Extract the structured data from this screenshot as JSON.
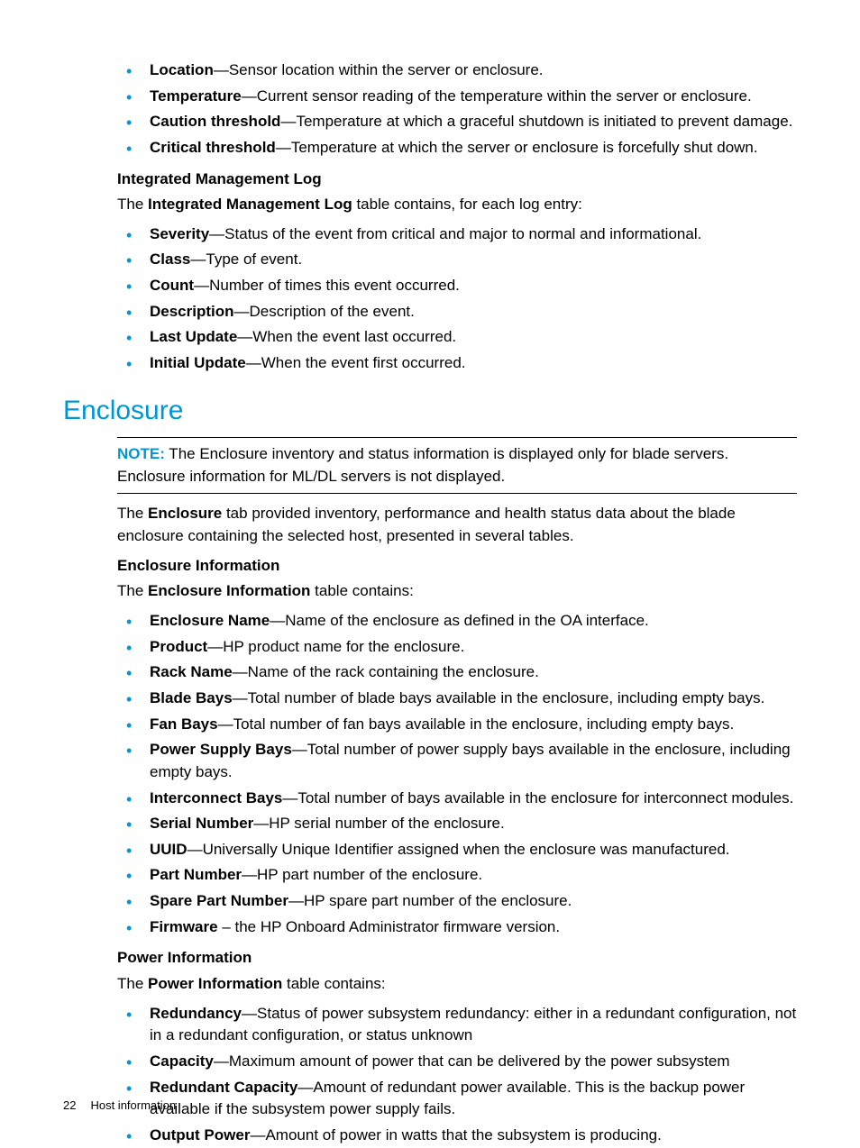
{
  "sensors": {
    "items": [
      {
        "term": "Location",
        "desc": "—Sensor location within the server or enclosure."
      },
      {
        "term": "Temperature",
        "desc": "—Current sensor reading of the temperature within the server or enclosure."
      },
      {
        "term": "Caution threshold",
        "desc": "—Temperature at which a graceful shutdown is initiated to prevent damage."
      },
      {
        "term": "Critical threshold",
        "desc": "—Temperature at which the server or enclosure is forcefully shut down."
      }
    ]
  },
  "iml": {
    "heading": "Integrated Management Log",
    "intro_pre": "The ",
    "intro_bold": "Integrated Management Log",
    "intro_post": " table contains, for each log entry:",
    "items": [
      {
        "term": "Severity",
        "desc": "—Status of the event from critical and major to normal and informational."
      },
      {
        "term": "Class",
        "desc": "—Type of event."
      },
      {
        "term": "Count",
        "desc": "—Number of times this event occurred."
      },
      {
        "term": "Description",
        "desc": "—Description of the event."
      },
      {
        "term": "Last Update",
        "desc": "—When the event last occurred."
      },
      {
        "term": "Initial Update",
        "desc": "—When the event first occurred."
      }
    ]
  },
  "enclosure": {
    "title": "Enclosure",
    "note_label": "NOTE:",
    "note_text": "   The Enclosure inventory and status information is displayed only for blade servers. Enclosure information for ML/DL servers is not displayed.",
    "intro_pre": "The ",
    "intro_bold": "Enclosure",
    "intro_post": " tab provided inventory, performance and health status data about the blade enclosure containing the selected host, presented in several tables.",
    "info_heading": "Enclosure Information",
    "info_intro_pre": "The ",
    "info_intro_bold": "Enclosure Information",
    "info_intro_post": " table contains:",
    "info_items": [
      {
        "term": "Enclosure Name",
        "desc": "—Name of the enclosure as defined in the OA interface."
      },
      {
        "term": "Product",
        "desc": "—HP product name for the enclosure."
      },
      {
        "term": "Rack Name",
        "desc": "—Name of the rack containing the enclosure."
      },
      {
        "term": "Blade Bays",
        "desc": "—Total number of blade bays available in the enclosure, including empty bays."
      },
      {
        "term": "Fan Bays",
        "desc": "—Total number of fan bays available in the enclosure, including empty bays."
      },
      {
        "term": "Power Supply Bays",
        "desc": "—Total number of power supply bays available in the enclosure, including empty bays."
      },
      {
        "term": "Interconnect Bays",
        "desc": "—Total number of bays available in the enclosure for interconnect modules."
      },
      {
        "term": "Serial Number",
        "desc": "—HP serial number of the enclosure."
      },
      {
        "term": "UUID",
        "desc": "—Universally Unique Identifier assigned when the enclosure was manufactured."
      },
      {
        "term": "Part Number",
        "desc": "—HP part number of the enclosure."
      },
      {
        "term": "Spare Part Number",
        "desc": "—HP spare part number of the enclosure."
      },
      {
        "term": "Firmware",
        "desc": " – the HP Onboard Administrator firmware version."
      }
    ],
    "power_heading": "Power Information",
    "power_intro_pre": "The ",
    "power_intro_bold": "Power Information",
    "power_intro_post": " table contains:",
    "power_items": [
      {
        "term": "Redundancy",
        "desc": "—Status of power subsystem redundancy: either in a redundant configuration, not in a redundant configuration, or status unknown"
      },
      {
        "term": "Capacity",
        "desc": "—Maximum amount of power that can be delivered by the power subsystem"
      },
      {
        "term": "Redundant Capacity",
        "desc": "—Amount of redundant power available. This is the backup power available if the subsystem power supply fails."
      },
      {
        "term": "Output Power",
        "desc": "—Amount of power in watts that the subsystem is producing."
      }
    ]
  },
  "footer": {
    "page": "22",
    "title": "Host information"
  }
}
